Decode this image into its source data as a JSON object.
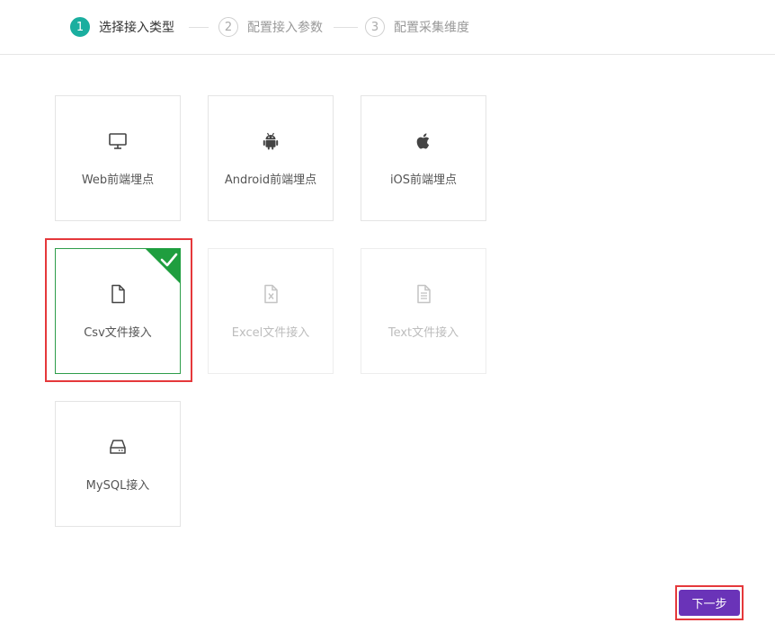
{
  "steps": [
    {
      "number": "1",
      "label": "选择接入类型",
      "active": true
    },
    {
      "number": "2",
      "label": "配置接入参数",
      "active": false
    },
    {
      "number": "3",
      "label": "配置采集维度",
      "active": false
    }
  ],
  "cards": [
    {
      "label": "Web前端埋点",
      "icon": "monitor-icon",
      "state": "normal"
    },
    {
      "label": "Android前端埋点",
      "icon": "android-icon",
      "state": "normal"
    },
    {
      "label": "iOS前端埋点",
      "icon": "apple-icon",
      "state": "normal"
    },
    {
      "label": "Csv文件接入",
      "icon": "file-icon",
      "state": "selected"
    },
    {
      "label": "Excel文件接入",
      "icon": "excel-file-icon",
      "state": "disabled"
    },
    {
      "label": "Text文件接入",
      "icon": "text-file-icon",
      "state": "disabled"
    },
    {
      "label": "MySQL接入",
      "icon": "database-drive-icon",
      "state": "normal"
    }
  ],
  "footer": {
    "next_label": "下一步"
  },
  "colors": {
    "step_active": "#1aae9f",
    "selected_border": "#2e9d4a",
    "check_badge": "#1f9e3f",
    "highlight": "#e5383b",
    "next_button": "#6a33b8"
  }
}
